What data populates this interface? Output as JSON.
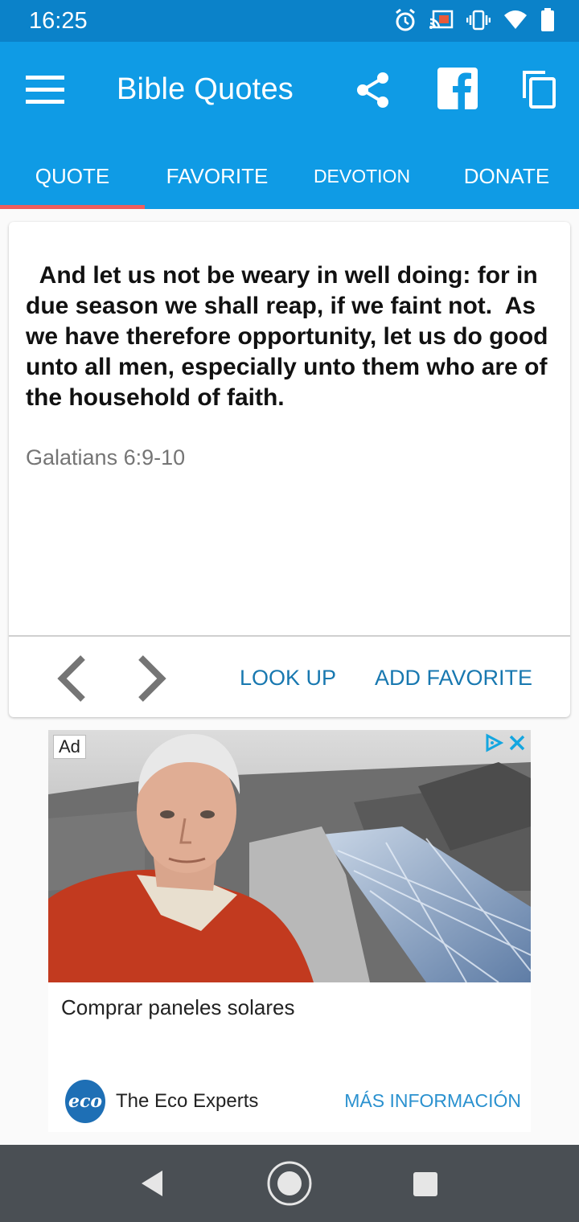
{
  "status_bar": {
    "time": "16:25",
    "icons": [
      "alarm-icon",
      "cast-icon",
      "vibrate-icon",
      "wifi-icon",
      "battery-icon"
    ]
  },
  "app_bar": {
    "title": "Bible Quotes",
    "background": "#0f9be5",
    "actions": [
      "menu-icon",
      "share-icon",
      "facebook-icon",
      "copy-icon"
    ]
  },
  "tabs": [
    {
      "label": "QUOTE",
      "active": true
    },
    {
      "label": "FAVORITE",
      "active": false
    },
    {
      "label": "DEVOTION",
      "active": false
    },
    {
      "label": "DONATE",
      "active": false
    }
  ],
  "quote": {
    "text": "  And let us not be weary in well doing: for in due season we shall reap, if we faint not.  As we have therefore opportunity, let us do good unto all men, especially unto them who are of the household of faith.",
    "reference": "Galatians 6:9-10"
  },
  "card_actions": {
    "prev_icon": "chevron-left-icon",
    "next_icon": "chevron-right-icon",
    "look_up": "LOOK UP",
    "add_favorite": "ADD FAVORITE"
  },
  "ad": {
    "badge": "Ad",
    "headline": "Comprar paneles solares",
    "advertiser": "The Eco Experts",
    "logo_text": "eco",
    "cta": "MÁS INFORMACIÓN"
  },
  "colors": {
    "status_bar": "#0b82c9",
    "accent_indicator": "#ee5d5d",
    "action_text": "#1878b0"
  }
}
